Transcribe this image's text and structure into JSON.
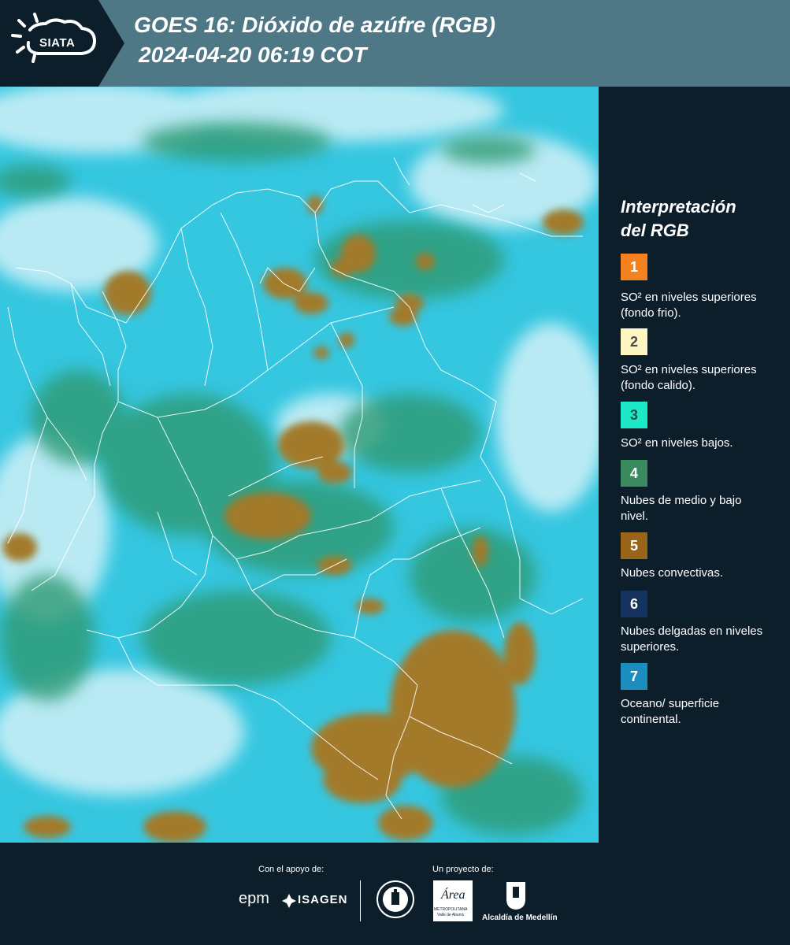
{
  "header": {
    "logo_text": "SIATA",
    "title_line1": "GOES 16: Dióxido de azúfre (RGB)",
    "title_line2": "2024-04-20 06:19 COT"
  },
  "legend": {
    "title_line1": "Interpretación",
    "title_line2": "del RGB",
    "items": [
      {
        "number": "1",
        "color": "#f58220",
        "text_color": "#ffffff",
        "label": "SO² en niveles superiores (fondo frio)."
      },
      {
        "number": "2",
        "color": "#fff7c2",
        "text_color": "#4a4a4a",
        "label": "SO² en niveles superiores (fondo calido)."
      },
      {
        "number": "3",
        "color": "#1de9c9",
        "text_color": "#1f4f4a",
        "label": "SO² en niveles bajos."
      },
      {
        "number": "4",
        "color": "#3b8a5f",
        "text_color": "#ffffff",
        "label": "Nubes de medio y bajo nivel."
      },
      {
        "number": "5",
        "color": "#9a6518",
        "text_color": "#ffffff",
        "label": "Nubes convectivas."
      },
      {
        "number": "6",
        "color": "#14345f",
        "text_color": "#ffffff",
        "label": "Nubes delgadas en niveles superiores."
      },
      {
        "number": "7",
        "color": "#1b8dbf",
        "text_color": "#ffffff",
        "label": "Oceano/ superficie continental."
      }
    ]
  },
  "footer": {
    "support_label": "Con el apoyo de:",
    "project_label": "Un proyecto de:",
    "logo_epm": "epm",
    "logo_isagen": "ISAGEN",
    "logo_metropolitana_line1": "METROPOLITANA",
    "logo_metropolitana_line2": "Valle de Aburrá",
    "logo_alcaldia": "Alcaldía de Medellín",
    "logo_area": "Área"
  },
  "map_colors": {
    "ocean_land": "#35c6e0",
    "cloud_white": "#e6f7fb",
    "mid_low_cloud": "#2f9a72",
    "convective": "#a27a2a",
    "border": "#ffffff"
  }
}
